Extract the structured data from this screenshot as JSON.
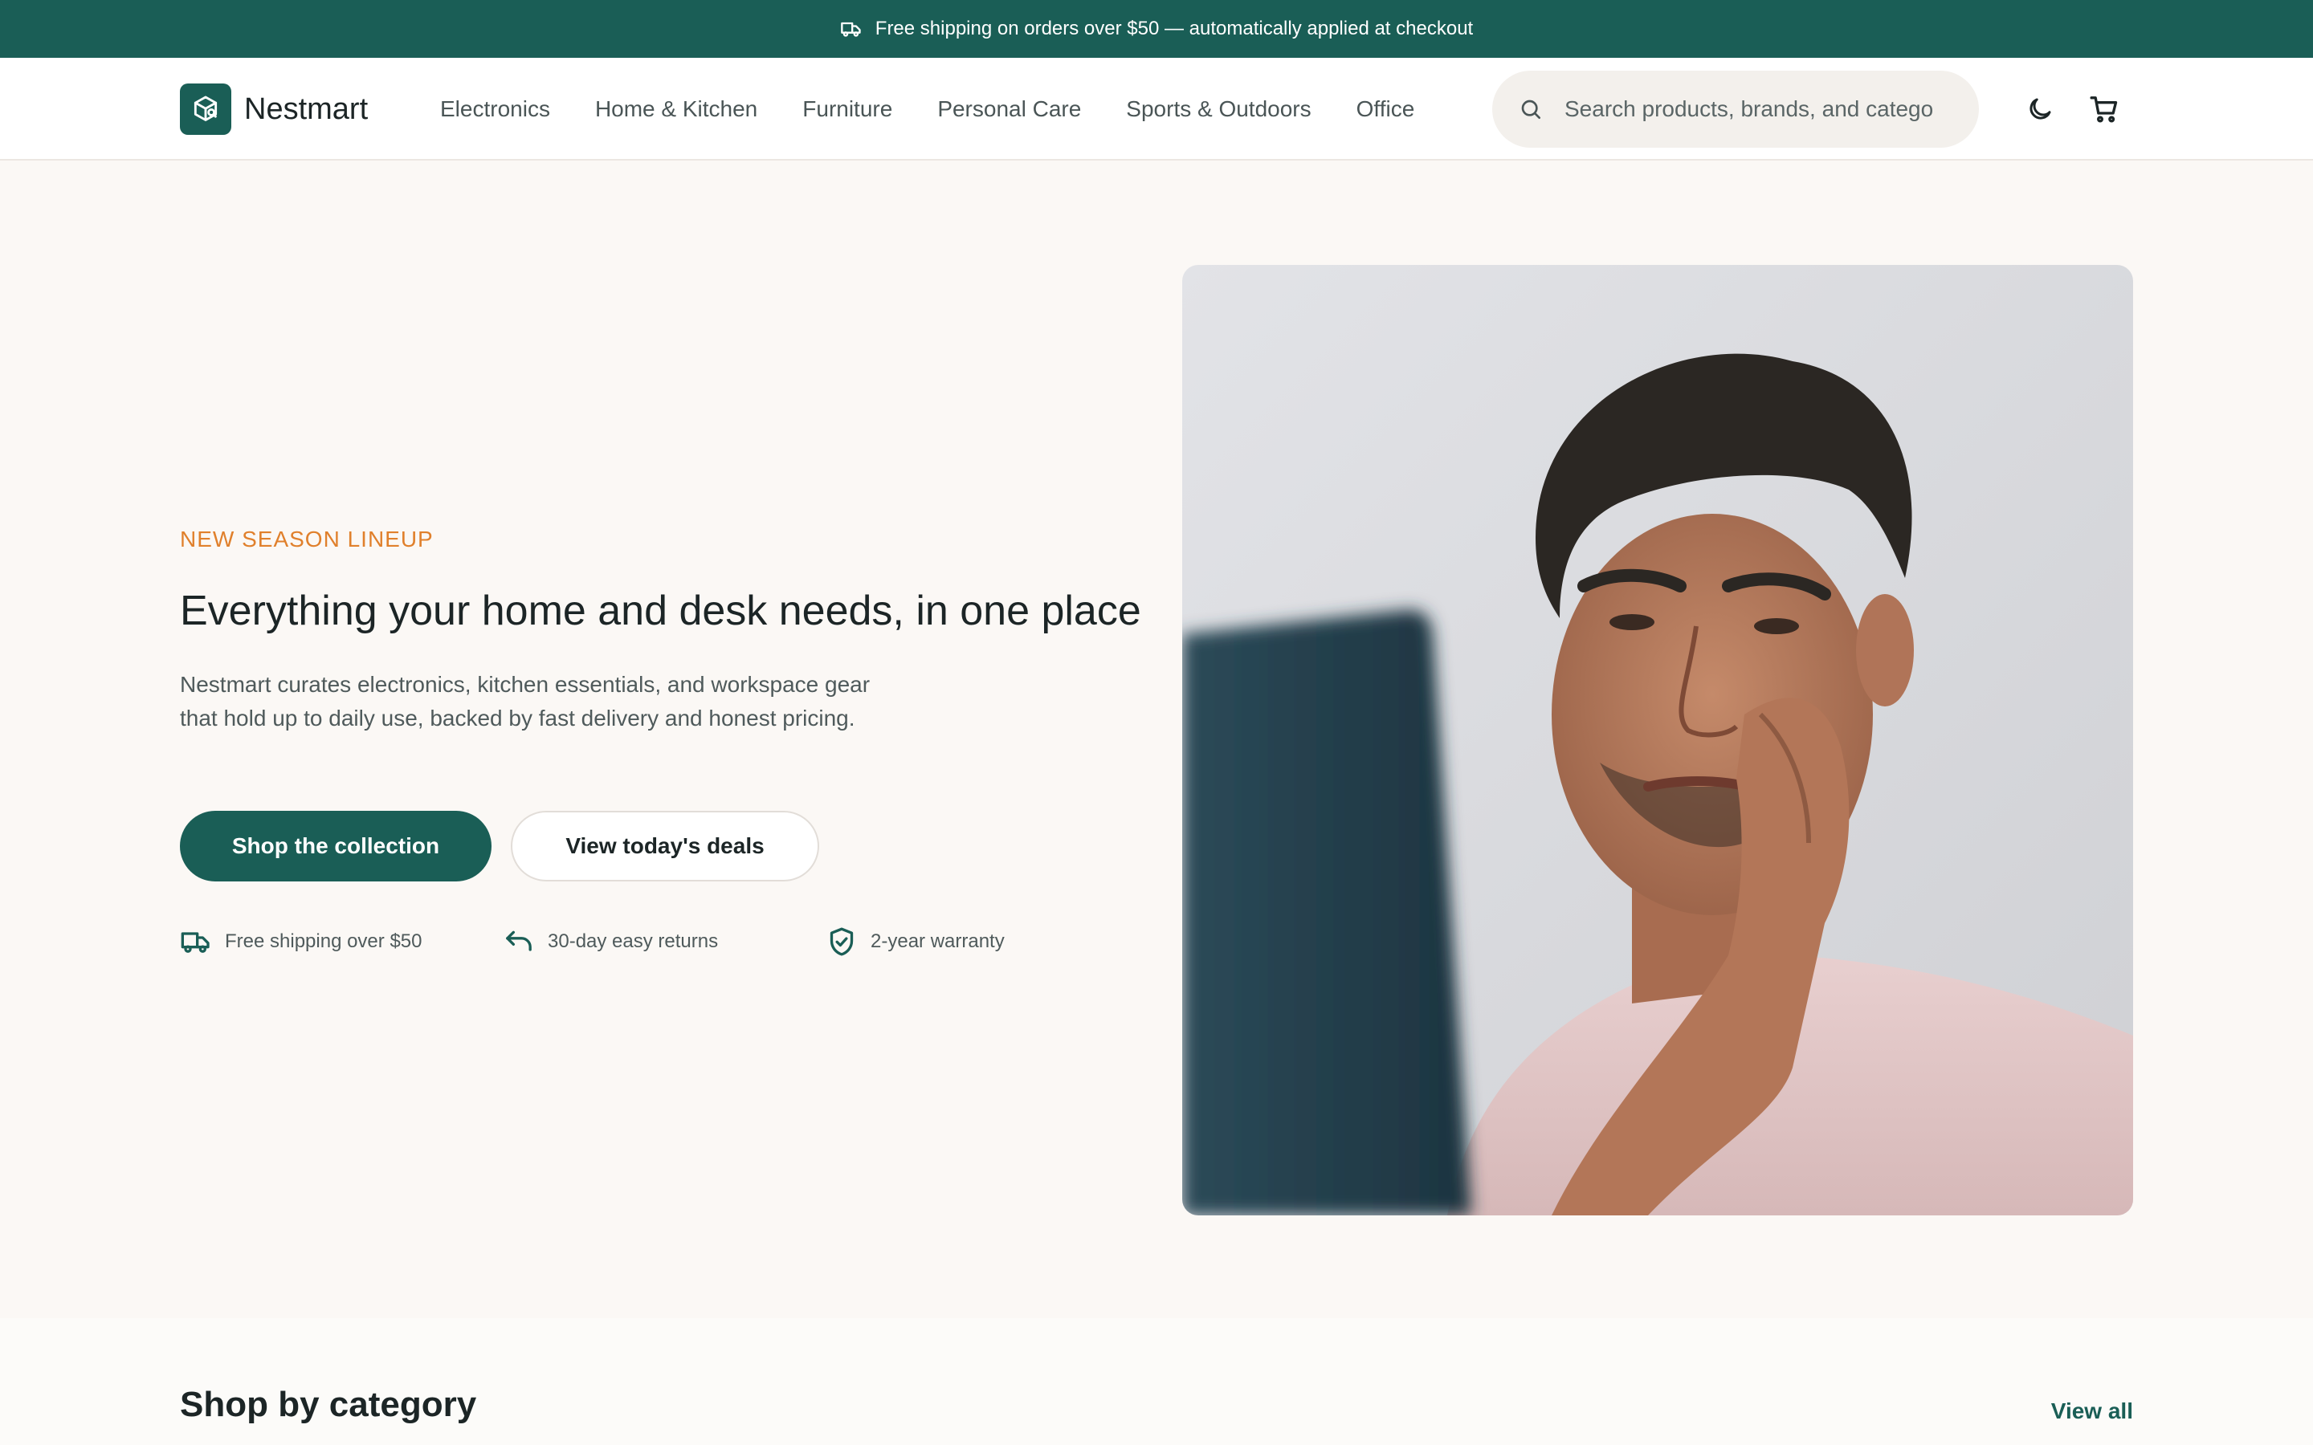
{
  "announcement": {
    "text": "Free shipping on orders over $50 — automatically applied at checkout"
  },
  "brand": {
    "name": "Nestmart"
  },
  "nav": {
    "links": [
      "Electronics",
      "Home & Kitchen",
      "Furniture",
      "Personal Care",
      "Sports & Outdoors",
      "Office"
    ]
  },
  "search": {
    "placeholder": "Search products, brands, and categories"
  },
  "icons": {
    "announcement": "truck-icon",
    "logo": "box-logo-icon",
    "search": "search-icon",
    "theme": "moon-icon",
    "cart": "cart-icon",
    "perks": [
      "truck-icon",
      "return-arrow-icon",
      "shield-check-icon"
    ]
  },
  "hero": {
    "eyebrow": "NEW SEASON LINEUP",
    "title": "Everything your home and desk needs, in one place",
    "subtitle": "Nestmart curates electronics, kitchen essentials, and workspace gear that hold up to daily use, backed by fast delivery and honest pricing.",
    "primary_cta": "Shop the collection",
    "secondary_cta": "View today's deals",
    "perks": [
      "Free shipping over $50",
      "30-day easy returns",
      "2-year warranty"
    ]
  },
  "categories": {
    "title": "Shop by category",
    "view_all": "View all"
  },
  "colors": {
    "brand": "#1a5e56",
    "accent": "#e0802c",
    "background": "#fbf8f5"
  }
}
